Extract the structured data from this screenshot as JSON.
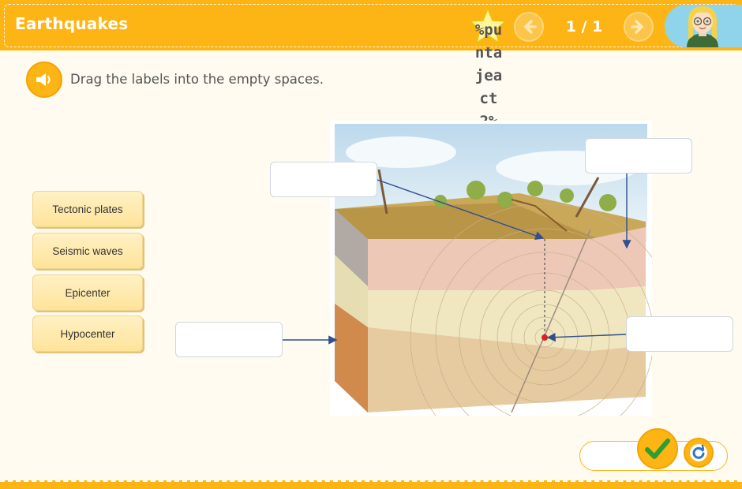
{
  "header": {
    "title": "Earthquakes",
    "score_text": "%puntajeact2%",
    "page_counter": "1 / 1",
    "prev_icon": "arrow-left-icon",
    "next_icon": "arrow-right-icon"
  },
  "instruction": {
    "icon": "speaker-icon",
    "text": "Drag the labels into the empty spaces."
  },
  "labels": [
    {
      "text": "Tectonic plates"
    },
    {
      "text": "Seismic waves"
    },
    {
      "text": "Epicenter"
    },
    {
      "text": "Hypocenter"
    }
  ],
  "drop_targets": [
    "",
    "",
    "",
    ""
  ],
  "controls": {
    "check_icon": "checkmark-icon",
    "reset_icon": "refresh-icon"
  },
  "colors": {
    "accent": "#fdb515",
    "background": "#fffbf0",
    "avatar_bg": "#8fd4ea",
    "arrow": "#2f4f8f",
    "epicenter_dot": "#e02020"
  }
}
